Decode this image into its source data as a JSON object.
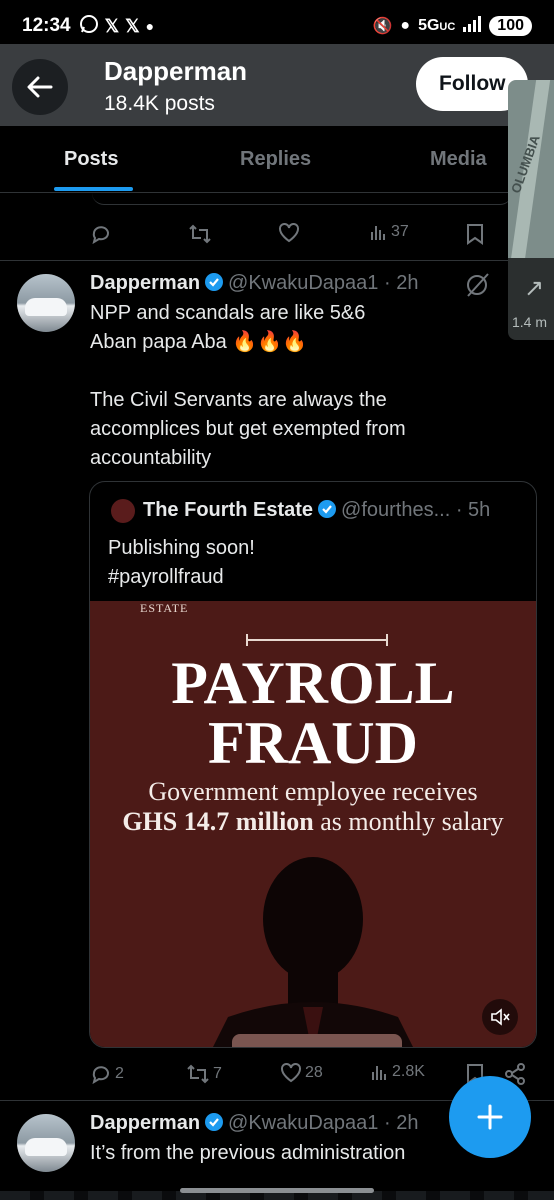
{
  "status_bar": {
    "time": "12:34",
    "left_icons": [
      "whatsapp-icon",
      "x-icon",
      "x-icon",
      "dot-icon"
    ],
    "network": "5G",
    "network_sub": "UC",
    "battery": "100"
  },
  "header": {
    "title": "Dapperman",
    "subtitle": "18.4K posts",
    "follow_label": "Follow"
  },
  "tabs": [
    {
      "label": "Posts",
      "active": true
    },
    {
      "label": "Replies",
      "active": false
    },
    {
      "label": "Media",
      "active": false
    }
  ],
  "map_overlay": {
    "street": "OLUMBIA",
    "distance": "1.4 m"
  },
  "prev_post_actions": {
    "views": "37"
  },
  "post": {
    "name": "Dapperman",
    "handle": "@KwakuDapaa1",
    "time": "2h",
    "line1": "NPP and scandals are like 5&6",
    "line2": "Aban papa Aba 🔥🔥🔥",
    "para2": "The Civil Servants are always the\naccomplices but get exempted from\naccountability",
    "quoted": {
      "name": "The Fourth Estate",
      "handle": "@fourthes...",
      "time": "5h",
      "text": "Publishing soon!\n#payrollfraud",
      "media": {
        "estate_label": "ESTATE",
        "headline_1": "PAYROLL",
        "headline_2": "FRAUD",
        "sub_1": "Government employee receives",
        "sub_2_bold": "GHS 14.7 million",
        "sub_2_rest": " as monthly salary"
      }
    },
    "actions": {
      "replies": "2",
      "reposts": "7",
      "likes": "28",
      "views": "2.8K"
    }
  },
  "next_post": {
    "name": "Dapperman",
    "handle": "@KwakuDapaa1",
    "time": "2h",
    "text": "It’s from the previous administration"
  },
  "colors": {
    "accent": "#1d9bf0",
    "media_bg": "#4c1a17",
    "header_bg": "#3a3d40"
  }
}
